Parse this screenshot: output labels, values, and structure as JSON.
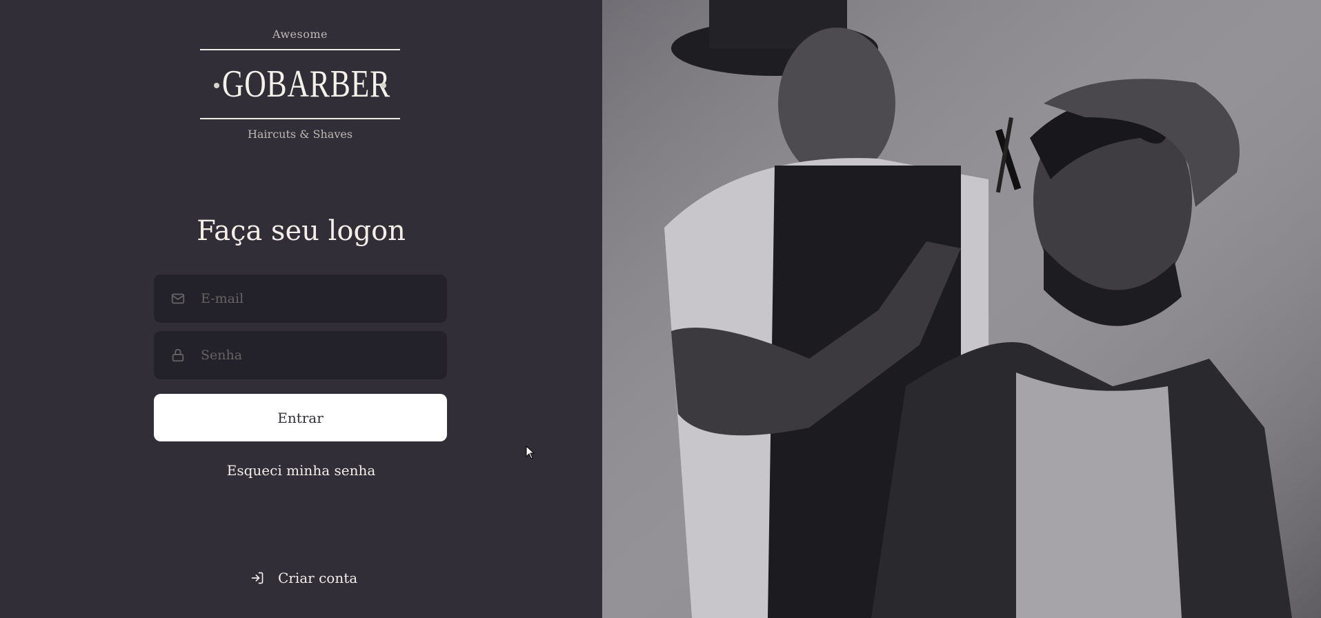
{
  "logo": {
    "top_text": "Awesome",
    "brand": "GOBARBER",
    "bottom_text": "Haircuts & Shaves"
  },
  "form": {
    "title": "Faça seu logon",
    "email_placeholder": "E-mail",
    "password_placeholder": "Senha",
    "submit_label": "Entrar",
    "forgot_label": "Esqueci minha senha"
  },
  "footer": {
    "create_account_label": "Criar conta"
  },
  "colors": {
    "background": "#312e38",
    "input_background": "#232129",
    "text": "#f4ede8",
    "placeholder": "#666360",
    "button": "#ffffff"
  },
  "icons": [
    "mail-icon",
    "lock-icon",
    "log-in-icon"
  ],
  "hero_image": "barber-photo"
}
